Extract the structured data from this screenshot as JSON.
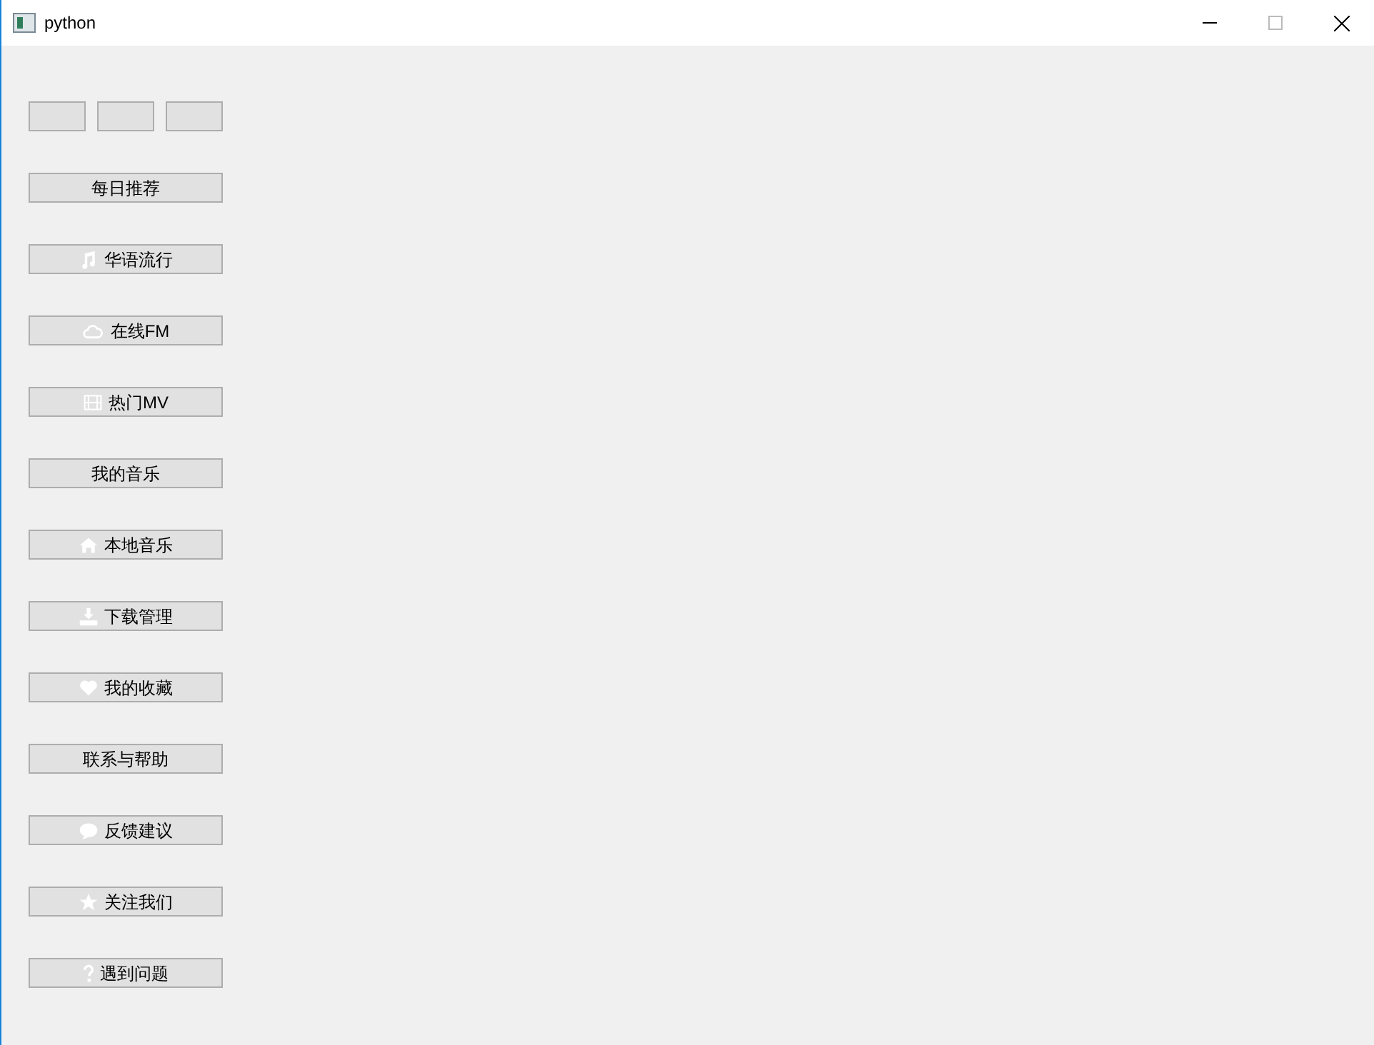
{
  "window": {
    "title": "python"
  },
  "top_buttons": [
    {
      "kind": "blank"
    },
    {
      "kind": "blank"
    },
    {
      "kind": "blank"
    }
  ],
  "menu": [
    {
      "label": "每日推荐",
      "kind": "plain"
    },
    {
      "label": "华语流行",
      "kind": "music"
    },
    {
      "label": "在线FM",
      "kind": "cloud"
    },
    {
      "label": "热门MV",
      "kind": "film"
    },
    {
      "label": "我的音乐",
      "kind": "plain"
    },
    {
      "label": "本地音乐",
      "kind": "home"
    },
    {
      "label": "下载管理",
      "kind": "download"
    },
    {
      "label": "我的收藏",
      "kind": "heart"
    },
    {
      "label": "联系与帮助",
      "kind": "plain"
    },
    {
      "label": "反馈建议",
      "kind": "chat"
    },
    {
      "label": "关注我们",
      "kind": "star"
    },
    {
      "label": "遇到问题",
      "kind": "question"
    }
  ]
}
